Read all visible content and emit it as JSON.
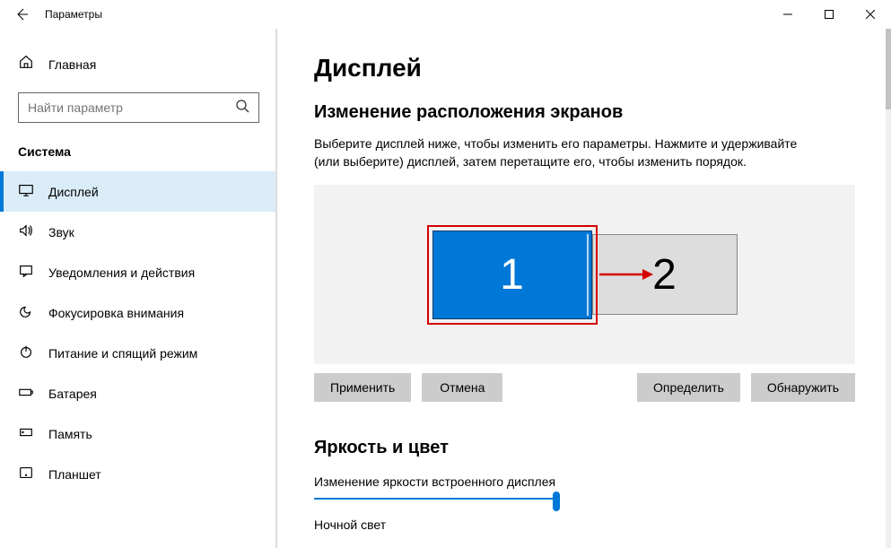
{
  "titlebar": {
    "title": "Параметры"
  },
  "sidebar": {
    "home": "Главная",
    "search_placeholder": "Найти параметр",
    "section": "Система",
    "items": [
      {
        "label": "Дисплей"
      },
      {
        "label": "Звук"
      },
      {
        "label": "Уведомления и действия"
      },
      {
        "label": "Фокусировка внимания"
      },
      {
        "label": "Питание и спящий режим"
      },
      {
        "label": "Батарея"
      },
      {
        "label": "Память"
      },
      {
        "label": "Планшет"
      }
    ]
  },
  "main": {
    "title": "Дисплей",
    "arrange_heading": "Изменение расположения экранов",
    "arrange_desc": "Выберите дисплей ниже, чтобы изменить его параметры. Нажмите и удерживайте (или выберите) дисплей, затем перетащите его, чтобы изменить порядок.",
    "monitor1": "1",
    "monitor2": "2",
    "btn_apply": "Применить",
    "btn_cancel": "Отмена",
    "btn_identify": "Определить",
    "btn_detect": "Обнаружить",
    "brightness_heading": "Яркость и цвет",
    "brightness_label": "Изменение яркости встроенного дисплея",
    "night_label": "Ночной свет"
  }
}
